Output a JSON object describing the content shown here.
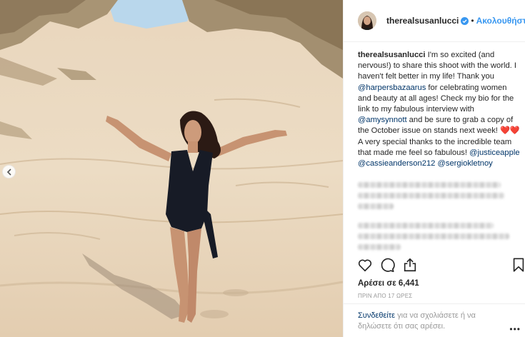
{
  "post": {
    "username": "therealsusanlucci",
    "separator": "•",
    "follow_label": "Ακολουθήστε",
    "caption": {
      "username": "therealsusanlucci",
      "part1": " I'm so excited (and nervous!) to share this shoot with the world. I haven't felt better in my life! Thank you ",
      "mention1": "@harpersbazaarus",
      "part2": " for celebrating women and beauty at all ages! Check my bio for the link to my fabulous interview with ",
      "mention2": "@amysynnott",
      "part3": " and be sure to grab a copy of the October issue on stands next week! ❤️❤️ A very special thanks to the incredible team that made me feel so fabulous! ",
      "mention3": "@justiceapple",
      "mention4": "@cassieanderson212",
      "mention5": "@sergiokletnoy"
    },
    "likes_text": "Αρέσει σε 6,441",
    "time_text": "ΠΡΙΝ ΑΠΟ 17 ΩΡΕΣ",
    "login_prompt": {
      "link": "Συνδεθείτε",
      "rest": " για να σχολιάσετε ή να δηλώσετε ότι σας αρέσει."
    },
    "more_dots": "•••"
  },
  "icons": {
    "like": "heart-icon",
    "comment": "comment-icon",
    "share": "share-icon",
    "save": "bookmark-icon",
    "verified": "verified-badge-icon",
    "carousel_prev": "chevron-left-icon"
  },
  "colors": {
    "link_blue": "#3897f0",
    "mention_navy": "#003569",
    "muted_gray": "#999999",
    "text": "#262626",
    "divider": "#efefef"
  }
}
